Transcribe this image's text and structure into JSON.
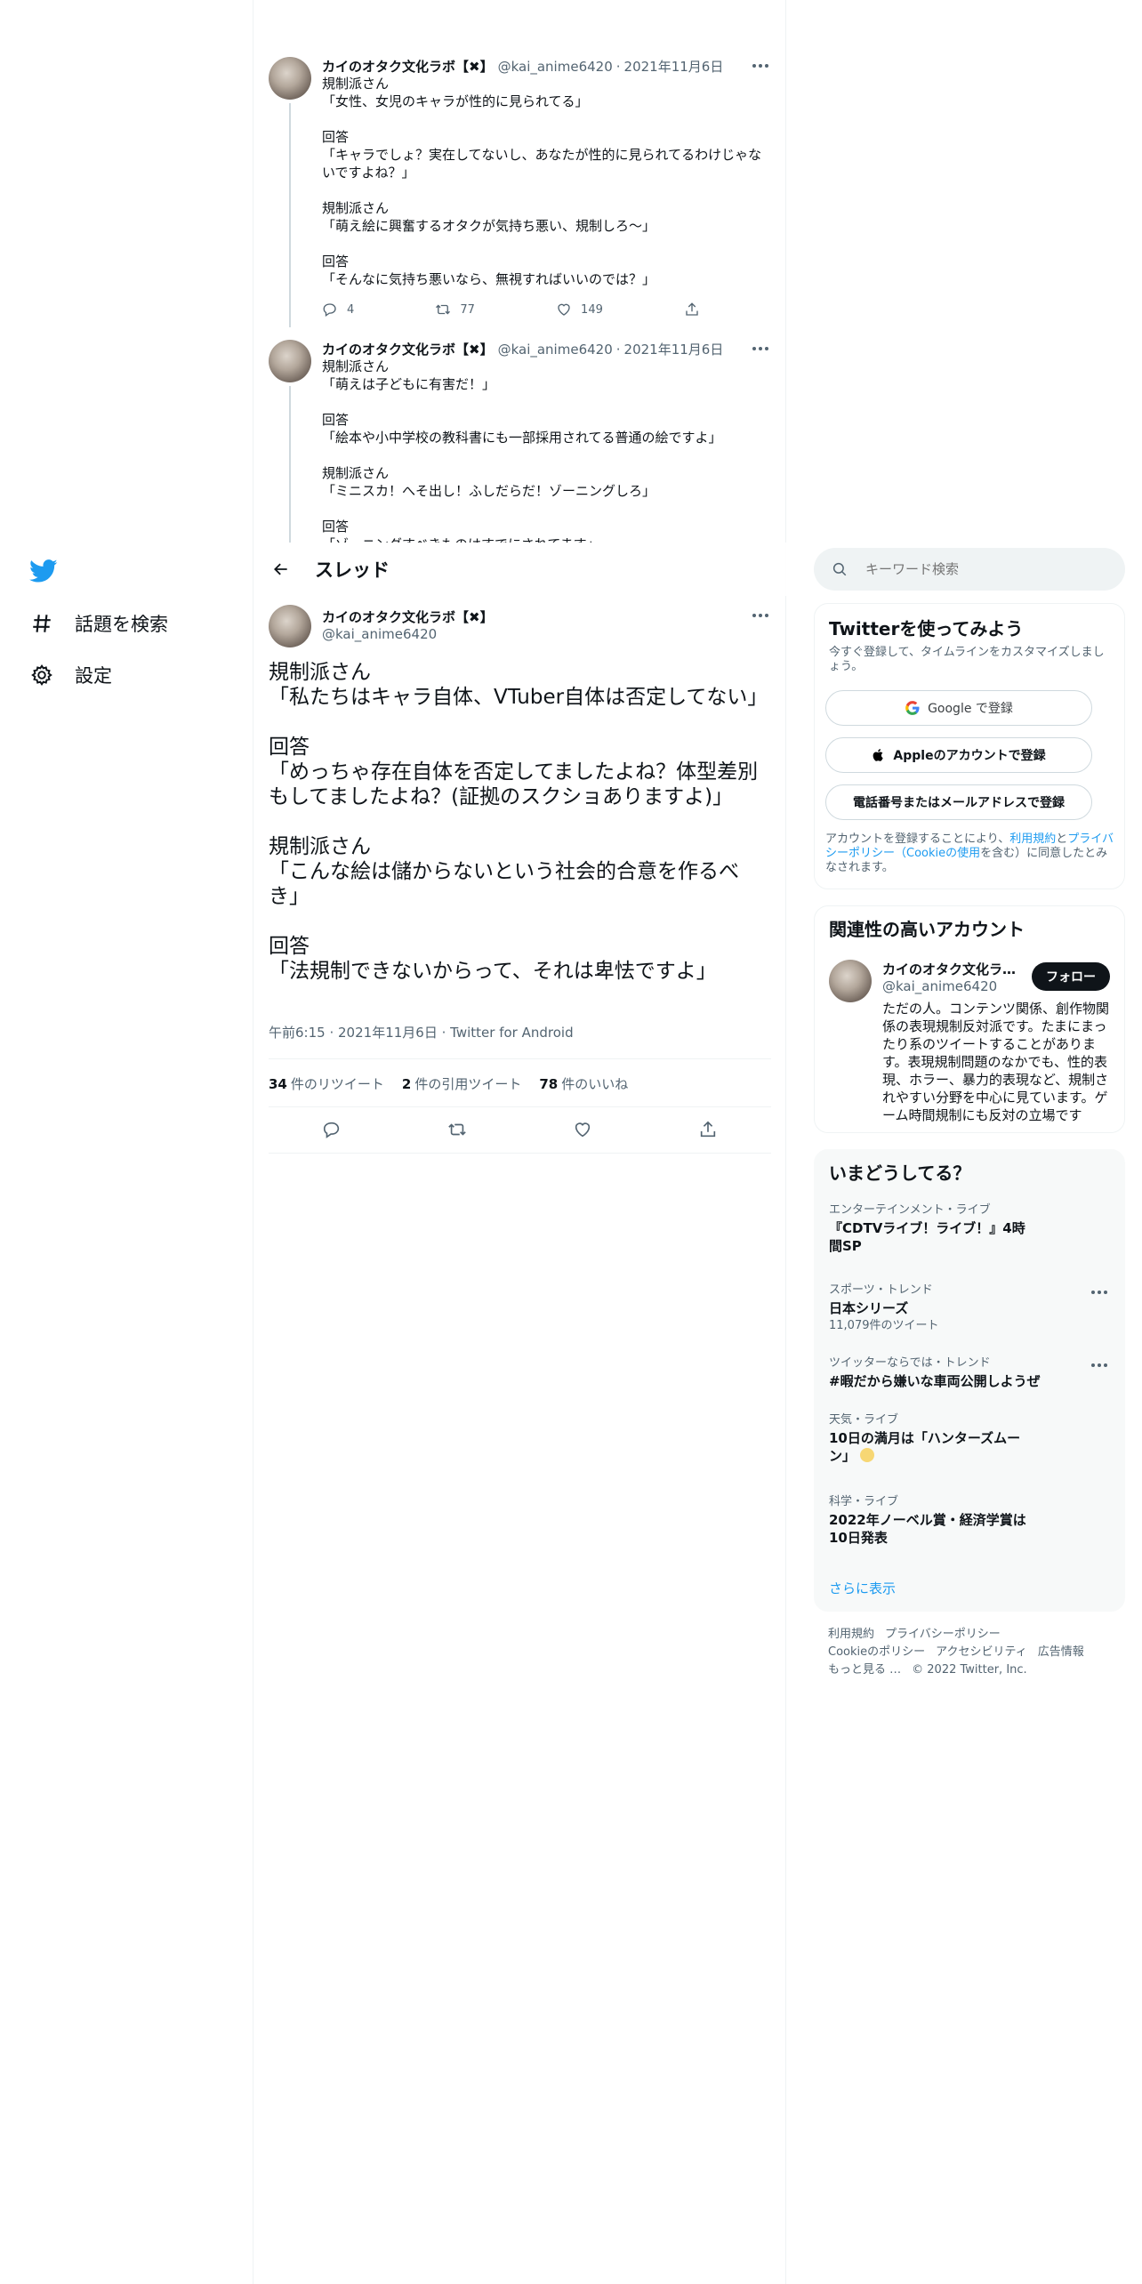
{
  "nav": {
    "explore_label": "話題を検索",
    "settings_label": "設定"
  },
  "tweets": [
    {
      "name": "カイのオタク文化ラボ【✖】",
      "handle": "@kai_anime6420",
      "date": "2021年11月6日",
      "text": "規制派さん\n「女性、女児のキャラが性的に見られてる」\n\n回答\n「キャラでしょ？実在してないし、あなたが性的に見られてるわけじゃないですよね？」\n\n規制派さん\n「萌え絵に興奮するオタクが気持ち悪い、規制しろ～」\n\n回答\n「そんなに気持ち悪いなら、無視すればいいのでは？」",
      "replies": "4",
      "retweets": "77",
      "likes": "149"
    },
    {
      "name": "カイのオタク文化ラボ【✖】",
      "handle": "@kai_anime6420",
      "date": "2021年11月6日",
      "text": "規制派さん\n「萌えは子どもに有害だ！」\n\n回答\n「絵本や小中学校の教科書にも一部採用されてる普通の絵ですよ」\n\n規制派さん\n「ミニスカ！へそ出し！ふしだらだ！ゾーニングしろ」\n\n回答\n「ゾーニングすべきものはすでにされてます」"
    }
  ],
  "header": {
    "title": "スレッド"
  },
  "focus": {
    "name": "カイのオタク文化ラボ【✖】",
    "handle": "@kai_anime6420",
    "text": "規制派さん\n「私たちはキャラ自体、VTuber自体は否定してない」\n\n回答\n「めっちゃ存在自体を否定してましたよね？体型差別もしてましたよね？(証拠のスクショありますよ)」\n\n規制派さん\n「こんな絵は儲からないという社会的合意を作るべき」\n\n回答\n「法規制できないからって、それは卑怯ですよ」",
    "time": "午前6:15",
    "date": "2021年11月6日",
    "source": "Twitter for Android",
    "retweets": "34",
    "retweets_label": "件のリツイート",
    "quotes": "2",
    "quotes_label": "件の引用ツイート",
    "likes": "78",
    "likes_label": "件のいいね"
  },
  "search": {
    "placeholder": "キーワード検索"
  },
  "signup": {
    "title": "Twitterを使ってみよう",
    "subtitle": "今すぐ登録して、タイムラインをカスタマイズしましょう。",
    "google": "Google で登録",
    "apple": "Appleのアカウントで登録",
    "phone": "電話番号またはメールアドレスで登録",
    "terms_1": "アカウントを登録することにより、",
    "terms_link_1": "利用規約",
    "terms_2": "と",
    "terms_link_2": "プライバシーポリシー（Cookieの使用",
    "terms_3": "を含む）に同意したとみなされます。"
  },
  "related": {
    "title": "関連性の高いアカウント",
    "name": "カイのオタク文化ラボ【✖】",
    "handle": "@kai_anime6420",
    "follow": "フォロー",
    "bio": "ただの人。コンテンツ関係、創作物関係の表現規制反対派です。たまにまったり系のツイートすることがあります。表現規制問題のなかでも、性的表現、ホラー、暴力的表現など、規制されやすい分野を中心に見ています。ゲーム時間規制にも反対の立場です"
  },
  "trends": {
    "title": "いまどうしてる？",
    "items": [
      {
        "category": "エンターテインメント・ライブ",
        "title": "『CDTVライブ！ライブ！』4時間SP",
        "count": ""
      },
      {
        "category": "スポーツ・トレンド",
        "title": "日本シリーズ",
        "count": "11,079件のツイート"
      },
      {
        "category": "ツイッターならでは・トレンド",
        "title": "#暇だから嫌いな車両公開しようぜ",
        "count": ""
      },
      {
        "category": "天気・ライブ",
        "title": "10日の満月は「ハンターズムーン」",
        "count": ""
      },
      {
        "category": "科学・ライブ",
        "title": "2022年ノーベル賞・経済学賞は10日発表",
        "count": ""
      }
    ],
    "show_more": "さらに表示"
  },
  "footer": {
    "terms": "利用規約",
    "privacy": "プライバシーポリシー",
    "cookie": "Cookieのポリシー",
    "accessibility": "アクセシビリティ",
    "ads": "広告情報",
    "more": "もっと見る …",
    "copyright": "© 2022 Twitter, Inc."
  },
  "colors": {
    "brand": "#1d9bf0",
    "text": "#0f1419",
    "secondary": "#536471"
  }
}
